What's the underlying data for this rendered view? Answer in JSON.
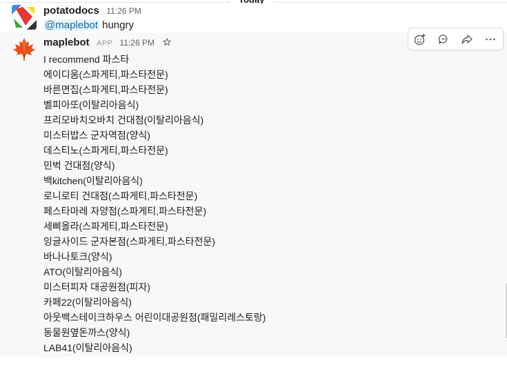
{
  "day_divider": "Today",
  "messages": [
    {
      "sender": "potatodocs",
      "time": "11:26 PM",
      "mention": "@maplebot",
      "text": "hungry"
    },
    {
      "sender": "maplebot",
      "badge": "APP",
      "time": "11:26 PM",
      "lines": [
        "I recommend 파스타",
        "에이디움(스파게티,파스타전문)",
        "바른면집(스파게티,파스타전문)",
        "벨피아또(이탈리아음식)",
        "프리모바치오바치 건대점(이탈리아음식)",
        "미스터밥스 군자역점(양식)",
        "데스티노(스파게티,파스타전문)",
        "민벅 건대점(양식)",
        "백kitchen(이탈리아음식)",
        "로니로티 건대점(스파게티,파스타전문)",
        "페스타마레 자양점(스파게티,파스타전문)",
        "세삐올라(스파게티,파스타전문)",
        "잉글사이드 군자본점(스파게티,파스타전문)",
        "바나나토크(양식)",
        "ATO(이탈리아음식)",
        "미스터피자 대공원점(피자)",
        "카페22(이탈리아음식)",
        "아웃백스테이크하우스 어린이대공원점(패밀리레스토랑)",
        "동물원옆돈까스(양식)",
        "LAB41(이탈리아음식)"
      ]
    }
  ],
  "toolbar_icons": [
    "add-reaction-icon",
    "reply-thread-icon",
    "share-icon",
    "more-actions-icon"
  ],
  "colors": {
    "mention": "#1264a3",
    "hover_bg": "#f8f8f8"
  }
}
